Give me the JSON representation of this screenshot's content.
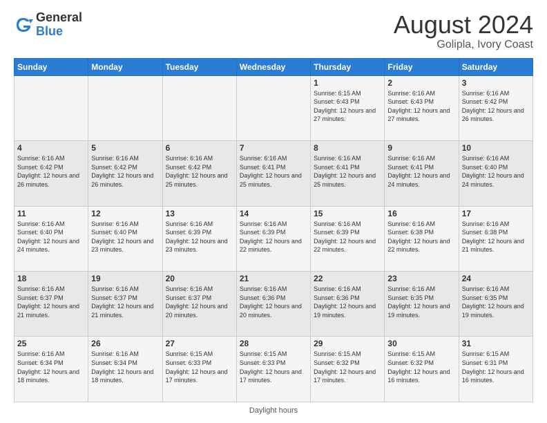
{
  "logo": {
    "general": "General",
    "blue": "Blue"
  },
  "header": {
    "title": "August 2024",
    "subtitle": "Golipla, Ivory Coast"
  },
  "days_of_week": [
    "Sunday",
    "Monday",
    "Tuesday",
    "Wednesday",
    "Thursday",
    "Friday",
    "Saturday"
  ],
  "footer": {
    "text": "Daylight hours"
  },
  "weeks": [
    [
      {
        "day": "",
        "info": ""
      },
      {
        "day": "",
        "info": ""
      },
      {
        "day": "",
        "info": ""
      },
      {
        "day": "",
        "info": ""
      },
      {
        "day": "1",
        "info": "Sunrise: 6:15 AM\nSunset: 6:43 PM\nDaylight: 12 hours\nand 27 minutes."
      },
      {
        "day": "2",
        "info": "Sunrise: 6:16 AM\nSunset: 6:43 PM\nDaylight: 12 hours\nand 27 minutes."
      },
      {
        "day": "3",
        "info": "Sunrise: 6:16 AM\nSunset: 6:42 PM\nDaylight: 12 hours\nand 26 minutes."
      }
    ],
    [
      {
        "day": "4",
        "info": "Sunrise: 6:16 AM\nSunset: 6:42 PM\nDaylight: 12 hours\nand 26 minutes."
      },
      {
        "day": "5",
        "info": "Sunrise: 6:16 AM\nSunset: 6:42 PM\nDaylight: 12 hours\nand 26 minutes."
      },
      {
        "day": "6",
        "info": "Sunrise: 6:16 AM\nSunset: 6:42 PM\nDaylight: 12 hours\nand 25 minutes."
      },
      {
        "day": "7",
        "info": "Sunrise: 6:16 AM\nSunset: 6:41 PM\nDaylight: 12 hours\nand 25 minutes."
      },
      {
        "day": "8",
        "info": "Sunrise: 6:16 AM\nSunset: 6:41 PM\nDaylight: 12 hours\nand 25 minutes."
      },
      {
        "day": "9",
        "info": "Sunrise: 6:16 AM\nSunset: 6:41 PM\nDaylight: 12 hours\nand 24 minutes."
      },
      {
        "day": "10",
        "info": "Sunrise: 6:16 AM\nSunset: 6:40 PM\nDaylight: 12 hours\nand 24 minutes."
      }
    ],
    [
      {
        "day": "11",
        "info": "Sunrise: 6:16 AM\nSunset: 6:40 PM\nDaylight: 12 hours\nand 24 minutes."
      },
      {
        "day": "12",
        "info": "Sunrise: 6:16 AM\nSunset: 6:40 PM\nDaylight: 12 hours\nand 23 minutes."
      },
      {
        "day": "13",
        "info": "Sunrise: 6:16 AM\nSunset: 6:39 PM\nDaylight: 12 hours\nand 23 minutes."
      },
      {
        "day": "14",
        "info": "Sunrise: 6:16 AM\nSunset: 6:39 PM\nDaylight: 12 hours\nand 22 minutes."
      },
      {
        "day": "15",
        "info": "Sunrise: 6:16 AM\nSunset: 6:39 PM\nDaylight: 12 hours\nand 22 minutes."
      },
      {
        "day": "16",
        "info": "Sunrise: 6:16 AM\nSunset: 6:38 PM\nDaylight: 12 hours\nand 22 minutes."
      },
      {
        "day": "17",
        "info": "Sunrise: 6:16 AM\nSunset: 6:38 PM\nDaylight: 12 hours\nand 21 minutes."
      }
    ],
    [
      {
        "day": "18",
        "info": "Sunrise: 6:16 AM\nSunset: 6:37 PM\nDaylight: 12 hours\nand 21 minutes."
      },
      {
        "day": "19",
        "info": "Sunrise: 6:16 AM\nSunset: 6:37 PM\nDaylight: 12 hours\nand 21 minutes."
      },
      {
        "day": "20",
        "info": "Sunrise: 6:16 AM\nSunset: 6:37 PM\nDaylight: 12 hours\nand 20 minutes."
      },
      {
        "day": "21",
        "info": "Sunrise: 6:16 AM\nSunset: 6:36 PM\nDaylight: 12 hours\nand 20 minutes."
      },
      {
        "day": "22",
        "info": "Sunrise: 6:16 AM\nSunset: 6:36 PM\nDaylight: 12 hours\nand 19 minutes."
      },
      {
        "day": "23",
        "info": "Sunrise: 6:16 AM\nSunset: 6:35 PM\nDaylight: 12 hours\nand 19 minutes."
      },
      {
        "day": "24",
        "info": "Sunrise: 6:16 AM\nSunset: 6:35 PM\nDaylight: 12 hours\nand 19 minutes."
      }
    ],
    [
      {
        "day": "25",
        "info": "Sunrise: 6:16 AM\nSunset: 6:34 PM\nDaylight: 12 hours\nand 18 minutes."
      },
      {
        "day": "26",
        "info": "Sunrise: 6:16 AM\nSunset: 6:34 PM\nDaylight: 12 hours\nand 18 minutes."
      },
      {
        "day": "27",
        "info": "Sunrise: 6:15 AM\nSunset: 6:33 PM\nDaylight: 12 hours\nand 17 minutes."
      },
      {
        "day": "28",
        "info": "Sunrise: 6:15 AM\nSunset: 6:33 PM\nDaylight: 12 hours\nand 17 minutes."
      },
      {
        "day": "29",
        "info": "Sunrise: 6:15 AM\nSunset: 6:32 PM\nDaylight: 12 hours\nand 17 minutes."
      },
      {
        "day": "30",
        "info": "Sunrise: 6:15 AM\nSunset: 6:32 PM\nDaylight: 12 hours\nand 16 minutes."
      },
      {
        "day": "31",
        "info": "Sunrise: 6:15 AM\nSunset: 6:31 PM\nDaylight: 12 hours\nand 16 minutes."
      }
    ]
  ]
}
